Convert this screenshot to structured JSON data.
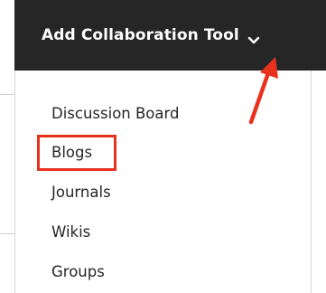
{
  "toolbar": {
    "button_label": "Add Collaboration Tool",
    "chevron_icon": "chevron-down-icon"
  },
  "menu": {
    "items": [
      {
        "label": "Discussion Board"
      },
      {
        "label": "Blogs",
        "highlighted": true
      },
      {
        "label": "Journals"
      },
      {
        "label": "Wikis"
      },
      {
        "label": "Groups"
      }
    ]
  },
  "annotations": {
    "highlight_color": "#e8321e",
    "arrow_color": "#e8321e",
    "highlight_target": "Blogs",
    "arrow_target": "chevron-down-icon"
  },
  "colors": {
    "toolbar_background": "#262626",
    "toolbar_text": "#ffffff",
    "menu_text": "#262626"
  }
}
